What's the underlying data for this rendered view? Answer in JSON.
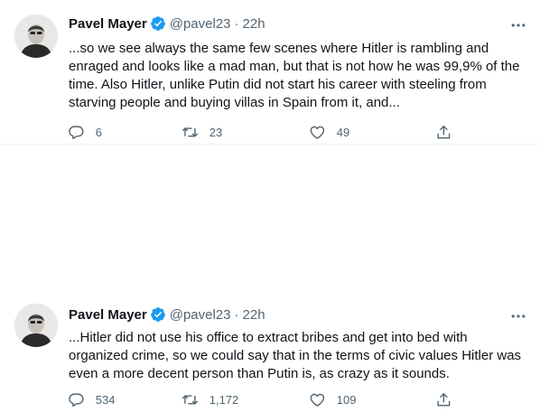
{
  "tweets": [
    {
      "author_name": "Pavel Mayer",
      "handle": "@pavel23",
      "separator": "·",
      "time": "22h",
      "text": "...so we see always the same few scenes where Hitler is rambling and enraged and looks like a mad man, but that is not how he was 99,9% of the time. Also Hitler, unlike Putin did not start his career with steeling from starving people and buying villas in Spain from it, and...",
      "replies": "6",
      "retweets": "23",
      "likes": "49"
    },
    {
      "author_name": "Pavel Mayer",
      "handle": "@pavel23",
      "separator": "·",
      "time": "22h",
      "text": "...Hitler did not use his office to extract bribes and get into bed with organized crime, so we could say that in the terms of civic values Hitler was even a more decent person than Putin is, as crazy as it sounds.",
      "replies": "534",
      "retweets": "1,172",
      "likes": "109"
    }
  ],
  "colors": {
    "verified": "#1d9bf0",
    "secondary": "#536471",
    "text": "#0f1419"
  },
  "icons": [
    "verified-badge-icon",
    "more-icon",
    "reply-icon",
    "retweet-icon",
    "like-icon",
    "share-icon"
  ]
}
